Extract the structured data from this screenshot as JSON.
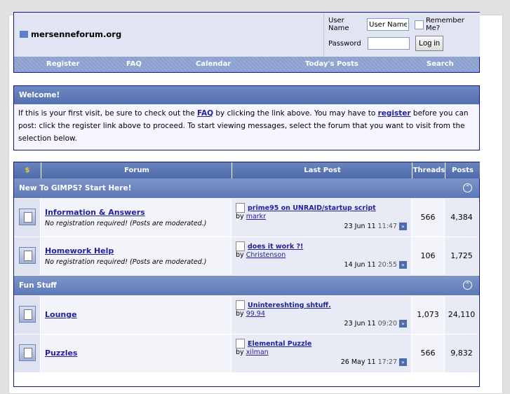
{
  "header": {
    "site_name": "mersenneforum.org",
    "username_label": "User Name",
    "username_value": "User Name",
    "remember_label": "Remember Me?",
    "password_label": "Password",
    "login_button": "Log in"
  },
  "nav": [
    "Register",
    "FAQ",
    "Calendar",
    "Today's Posts",
    "Search"
  ],
  "welcome": {
    "title": "Welcome!",
    "text_1": "If this is your first visit, be sure to check out the ",
    "faq_link": "FAQ",
    "text_2": " by clicking the link above. You may have to ",
    "register_link": "register",
    "text_3": " before you can post: click the register link above to proceed. To start viewing messages, select the forum that you want to visit from the selection below."
  },
  "table": {
    "col_icon": "$",
    "col_forum": "Forum",
    "col_last": "Last Post",
    "col_threads": "Threads",
    "col_posts": "Posts",
    "categories": [
      {
        "title": "New To GIMPS? Start Here!",
        "forums": [
          {
            "name": "Information & Answers",
            "desc": "No registration required! (Posts are moderated.)",
            "last_title": "prime95 on UNRAID/startup script",
            "by": "by ",
            "last_user": "markr",
            "date": "23 Jun 11",
            "time": "11:47",
            "threads": "566",
            "posts": "4,384"
          },
          {
            "name": "Homework Help",
            "desc": "No registration required! (Posts are moderated.)",
            "last_title": "does it work ?!",
            "by": "by ",
            "last_user": "Christenson",
            "date": "14 Jun 11",
            "time": "20:55",
            "threads": "106",
            "posts": "1,725"
          }
        ]
      },
      {
        "title": "Fun Stuff",
        "forums": [
          {
            "name": "Lounge",
            "desc": "",
            "last_title": "Unintereshting shtuff.",
            "by": "by ",
            "last_user": "99.94",
            "date": "23 Jun 11",
            "time": "09:20",
            "threads": "1,073",
            "posts": "24,110"
          },
          {
            "name": "Puzzles",
            "desc": "",
            "last_title": "Elemental Puzzle",
            "by": "by ",
            "last_user": "xilman",
            "date": "26 May 11",
            "time": "17:27",
            "threads": "566",
            "posts": "9,832"
          }
        ]
      }
    ]
  }
}
